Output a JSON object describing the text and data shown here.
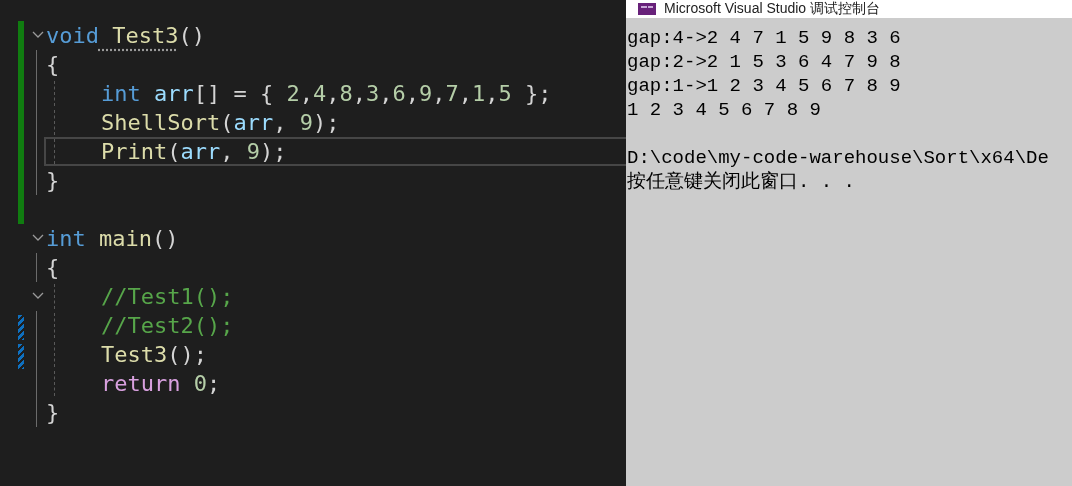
{
  "editor": {
    "lines": [
      {
        "fold": true,
        "indented": false,
        "saved_change": true,
        "unsaved_change": false,
        "current": false,
        "tokens": [
          {
            "text": "void",
            "kind": "keyword"
          },
          {
            "text": " Test3",
            "kind": "function",
            "hint": true
          },
          {
            "text": "()",
            "kind": "punct"
          }
        ]
      },
      {
        "fold": false,
        "indented": false,
        "saved_change": true,
        "unsaved_change": false,
        "current": false,
        "tokens": [
          {
            "text": "{",
            "kind": "punct"
          }
        ]
      },
      {
        "fold": false,
        "indented": true,
        "saved_change": true,
        "unsaved_change": false,
        "current": false,
        "tokens": [
          {
            "text": "int",
            "kind": "keyword"
          },
          {
            "text": " arr",
            "kind": "variable"
          },
          {
            "text": "[] = { ",
            "kind": "punct"
          },
          {
            "text": "2",
            "kind": "number"
          },
          {
            "text": ",",
            "kind": "punct"
          },
          {
            "text": "4",
            "kind": "number"
          },
          {
            "text": ",",
            "kind": "punct"
          },
          {
            "text": "8",
            "kind": "number"
          },
          {
            "text": ",",
            "kind": "punct"
          },
          {
            "text": "3",
            "kind": "number"
          },
          {
            "text": ",",
            "kind": "punct"
          },
          {
            "text": "6",
            "kind": "number"
          },
          {
            "text": ",",
            "kind": "punct"
          },
          {
            "text": "9",
            "kind": "number"
          },
          {
            "text": ",",
            "kind": "punct"
          },
          {
            "text": "7",
            "kind": "number"
          },
          {
            "text": ",",
            "kind": "punct"
          },
          {
            "text": "1",
            "kind": "number"
          },
          {
            "text": ",",
            "kind": "punct"
          },
          {
            "text": "5",
            "kind": "number"
          },
          {
            "text": " };",
            "kind": "punct"
          }
        ]
      },
      {
        "fold": false,
        "indented": true,
        "saved_change": true,
        "unsaved_change": false,
        "current": false,
        "tokens": [
          {
            "text": "ShellSort",
            "kind": "function"
          },
          {
            "text": "(",
            "kind": "punct"
          },
          {
            "text": "arr",
            "kind": "variable"
          },
          {
            "text": ", ",
            "kind": "punct"
          },
          {
            "text": "9",
            "kind": "number"
          },
          {
            "text": ");",
            "kind": "punct"
          }
        ]
      },
      {
        "fold": false,
        "indented": true,
        "saved_change": true,
        "unsaved_change": false,
        "current": true,
        "tokens": [
          {
            "text": "Print",
            "kind": "function"
          },
          {
            "text": "(",
            "kind": "punct"
          },
          {
            "text": "arr",
            "kind": "variable"
          },
          {
            "text": ", ",
            "kind": "punct"
          },
          {
            "text": "9",
            "kind": "number"
          },
          {
            "text": ");",
            "kind": "punct"
          }
        ]
      },
      {
        "fold": false,
        "indented": false,
        "saved_change": true,
        "unsaved_change": false,
        "current": false,
        "tokens": [
          {
            "text": "}",
            "kind": "punct"
          }
        ]
      },
      {
        "fold": false,
        "indented": false,
        "saved_change": true,
        "unsaved_change": false,
        "current": false
      },
      {
        "fold": true,
        "indented": false,
        "saved_change": false,
        "unsaved_change": false,
        "current": false,
        "tokens": [
          {
            "text": "int",
            "kind": "keyword"
          },
          {
            "text": " main",
            "kind": "function"
          },
          {
            "text": "()",
            "kind": "punct"
          }
        ]
      },
      {
        "fold": false,
        "indented": false,
        "saved_change": false,
        "unsaved_change": false,
        "current": false,
        "tokens": [
          {
            "text": "{",
            "kind": "punct"
          }
        ]
      },
      {
        "fold": true,
        "indented": true,
        "saved_change": false,
        "unsaved_change": false,
        "current": false,
        "tokens": [
          {
            "text": "//Test1();",
            "kind": "comment"
          }
        ]
      },
      {
        "fold": false,
        "indented": true,
        "saved_change": false,
        "unsaved_change": true,
        "current": false,
        "tokens": [
          {
            "text": "//Test2();",
            "kind": "comment"
          }
        ]
      },
      {
        "fold": false,
        "indented": true,
        "saved_change": false,
        "unsaved_change": true,
        "current": false,
        "tokens": [
          {
            "text": "Test3",
            "kind": "function"
          },
          {
            "text": "();",
            "kind": "punct"
          }
        ]
      },
      {
        "fold": false,
        "indented": true,
        "saved_change": false,
        "unsaved_change": false,
        "current": false,
        "tokens": [
          {
            "text": "return",
            "kind": "control"
          },
          {
            "text": " 0",
            "kind": "number"
          },
          {
            "text": ";",
            "kind": "punct"
          }
        ]
      },
      {
        "fold": false,
        "indented": false,
        "saved_change": false,
        "unsaved_change": false,
        "current": false,
        "tokens": [
          {
            "text": "}",
            "kind": "punct"
          }
        ]
      }
    ]
  },
  "console": {
    "title": "Microsoft Visual Studio 调试控制台",
    "output": [
      "gap:4->2 4 7 1 5 9 8 3 6",
      "gap:2->2 1 5 3 6 4 7 9 8",
      "gap:1->1 2 3 4 5 6 7 8 9",
      "1 2 3 4 5 6 7 8 9"
    ],
    "footer": [
      "D:\\code\\my-code-warehouse\\Sort\\x64\\De",
      "按任意键关闭此窗口. . ."
    ]
  }
}
